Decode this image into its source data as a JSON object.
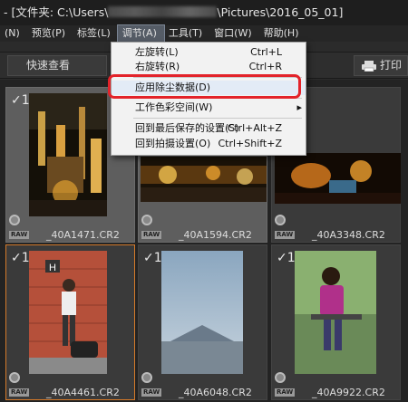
{
  "window": {
    "title_prefix": "- [文件夹: C:\\Users\\",
    "title_suffix": "\\Pictures\\2016_05_01]"
  },
  "menubar": {
    "items": [
      {
        "label": "(N)"
      },
      {
        "label": "预览(P)"
      },
      {
        "label": "标签(L)"
      },
      {
        "label": "调节(A)"
      },
      {
        "label": "工具(T)"
      },
      {
        "label": "窗口(W)"
      },
      {
        "label": "帮助(H)"
      }
    ]
  },
  "toolbar": {
    "quick_view_label": "快速查看",
    "print_label": "打印"
  },
  "dropdown": {
    "items": [
      {
        "label": "左旋转(L)",
        "shortcut": "Ctrl+L"
      },
      {
        "label": "右旋转(R)",
        "shortcut": "Ctrl+R"
      },
      {
        "label": "应用除尘数据(D)",
        "shortcut": ""
      },
      {
        "label": "工作色彩空间(W)",
        "shortcut": "▸"
      },
      {
        "label": "回到最后保存的设置(S)",
        "shortcut": "Ctrl+Alt+Z"
      },
      {
        "label": "回到拍摄设置(O)",
        "shortcut": "Ctrl+Shift+Z"
      }
    ]
  },
  "thumbnails": [
    {
      "filename": "_40A1471.CR2",
      "check": "✓1",
      "raw": "RAW"
    },
    {
      "filename": "_40A1594.CR2",
      "check": "",
      "raw": "RAW"
    },
    {
      "filename": "_40A3348.CR2",
      "check": "",
      "raw": "RAW"
    },
    {
      "filename": "_40A4461.CR2",
      "check": "✓1",
      "raw": "RAW"
    },
    {
      "filename": "_40A6048.CR2",
      "check": "✓1",
      "raw": "RAW"
    },
    {
      "filename": "_40A9922.CR2",
      "check": "✓1",
      "raw": "RAW"
    }
  ],
  "colors": {
    "accent_highlight": "#e3232a",
    "focus_border": "#d47a2a"
  }
}
